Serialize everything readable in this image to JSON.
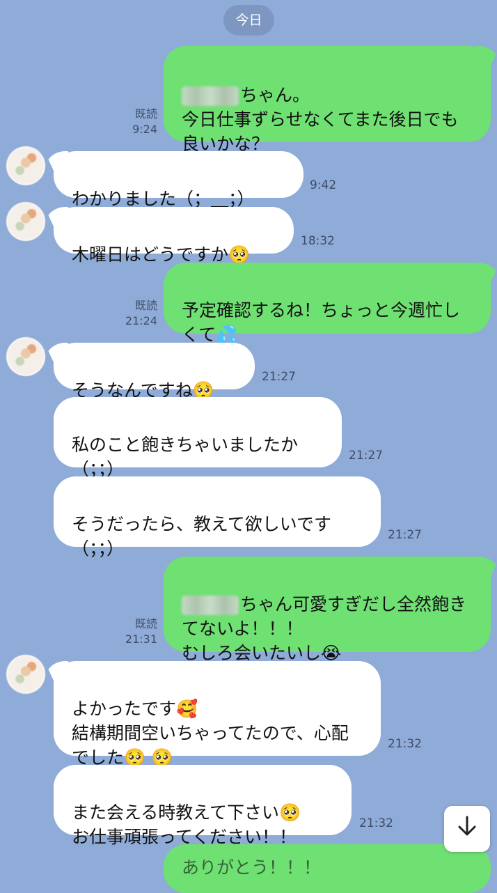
{
  "date_divider": "今日",
  "read_label": "既読",
  "messages": [
    {
      "side": "out",
      "name_blurred": true,
      "text": "ちゃん。\n今日仕事ずらせなくてまた後日でも良いかな？",
      "time": "9:24"
    },
    {
      "side": "in",
      "text": "わかりました（；＿；）",
      "time": "9:42"
    },
    {
      "side": "in",
      "text": "木曜日はどうですか",
      "emoji": "🥺",
      "time": "18:32"
    },
    {
      "side": "out",
      "text": "予定確認するね！ちょっと今週忙しくて",
      "emoji": "💦",
      "time": "21:24"
    },
    {
      "side": "in",
      "text": "そうなんですね",
      "emoji": "🥺",
      "time": "21:27"
    },
    {
      "side": "in",
      "text": "私のこと飽きちゃいましたか\n（；；）",
      "time": "21:27"
    },
    {
      "side": "in",
      "text": "そうだったら、教えて欲しいです\n（；；）",
      "time": "21:27"
    },
    {
      "side": "out",
      "name_blurred": true,
      "text": "ちゃん可愛すぎだし全然飽きてないよ！！！\nむしろ会いたいし",
      "emoji": "😭",
      "time": "21:31"
    },
    {
      "side": "in",
      "text": "よかったです",
      "emoji": "🥰",
      "text2": "結構期間空いちゃってたので、心配でした",
      "emoji2": "🥺 🥺",
      "time": "21:32"
    },
    {
      "side": "in",
      "text": "また会える時教えて下さい",
      "emoji": "🥺",
      "text2": "お仕事頑張ってください！！",
      "time": "21:32"
    }
  ],
  "partial_message": "ありがとう！！！",
  "scroll_button_icon": "arrow-down-icon",
  "colors": {
    "background": "#8fabd8",
    "outgoing_bubble": "#6fe072",
    "incoming_bubble": "#ffffff"
  }
}
